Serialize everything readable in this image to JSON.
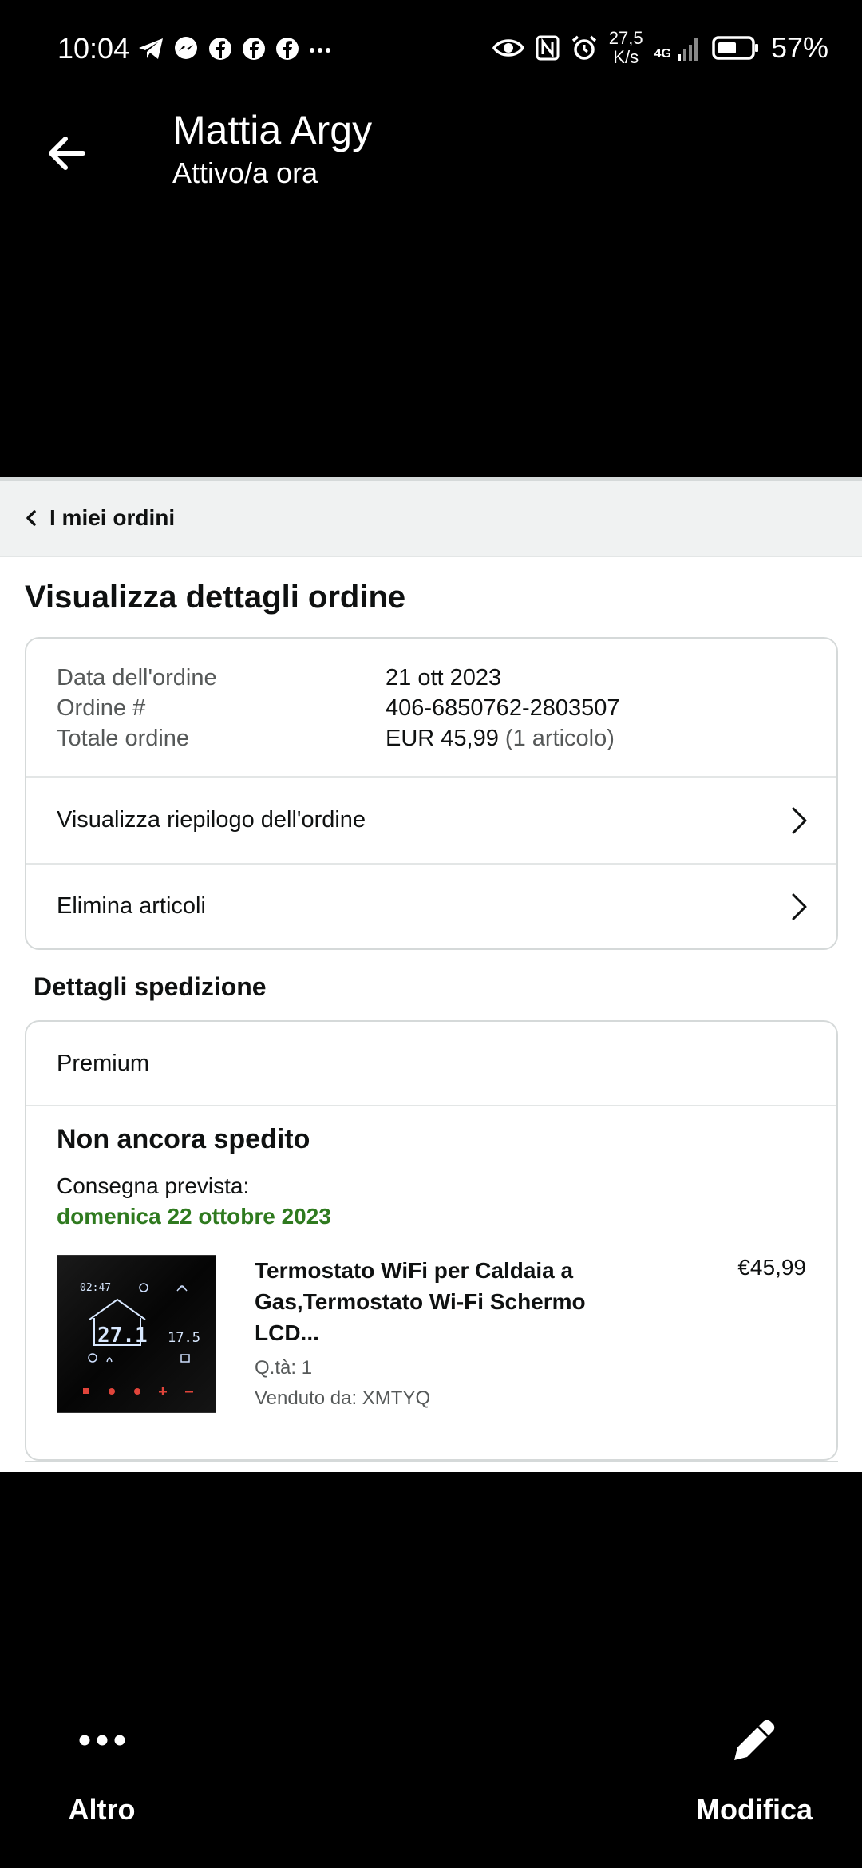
{
  "status_bar": {
    "time": "10:04",
    "speed_value": "27,5",
    "speed_unit": "K/s",
    "network": "4G",
    "battery": "57%"
  },
  "chat": {
    "contact_name": "Mattia Argy",
    "contact_status": "Attivo/a ora"
  },
  "order_page": {
    "breadcrumb": "I miei ordini",
    "title": "Visualizza dettagli ordine",
    "info": {
      "date_label": "Data dell'ordine",
      "date_value": "21 ott 2023",
      "number_label": "Ordine #",
      "number_value": "406-6850762-2803507",
      "total_label": "Totale ordine",
      "total_value": "EUR 45,99",
      "total_items": "(1 articolo)"
    },
    "links": {
      "summary": "Visualizza riepilogo dell'ordine",
      "delete": "Elimina articoli"
    },
    "shipping": {
      "section_title": "Dettagli spedizione",
      "service": "Premium",
      "status": "Non ancora spedito",
      "eta_label": "Consegna prevista:",
      "eta_date": "domenica 22 ottobre 2023",
      "eta_color": "#2f7a1f",
      "product": {
        "title": "Termostato WiFi per Caldaia a Gas,Termostato Wi-Fi Schermo LCD...",
        "price": "€45,99",
        "qty": "Q.tà: 1",
        "seller": "Venduto da: XMTYQ",
        "display_time": "02:47",
        "display_temp": "27.1",
        "display_set": "17.5"
      }
    }
  },
  "actions": {
    "more_label": "Altro",
    "edit_label": "Modifica"
  }
}
